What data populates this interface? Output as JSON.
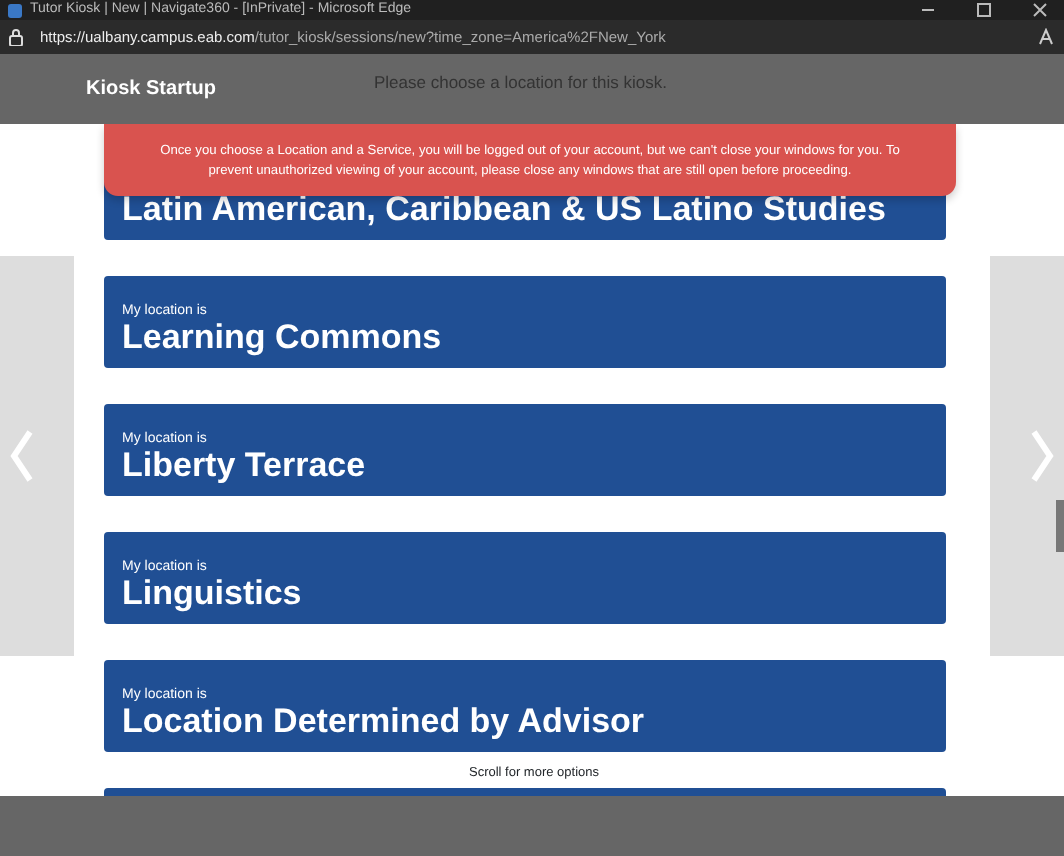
{
  "window": {
    "title": "Tutor Kiosk | New | Navigate360 - [InPrivate] - Microsoft Edge"
  },
  "address_bar": {
    "url_host": "https://ualbany.campus.eab.com",
    "url_path": "/tutor_kiosk/sessions/new?time_zone=America%2FNew_York"
  },
  "header": {
    "title": "Kiosk Startup",
    "prompt": "Please choose a location for this kiosk."
  },
  "alert": {
    "text": "Once you choose a Location and a Service, you will be logged out of your account, but we can't close your windows for you. To prevent unauthorized viewing of your account, please close any windows that are still open before proceeding."
  },
  "locations": [
    {
      "name": "Latin American, Caribbean & US Latino Studies"
    },
    {
      "label": "My location is",
      "name": "Learning Commons"
    },
    {
      "label": "My location is",
      "name": "Liberty Terrace"
    },
    {
      "label": "My location is",
      "name": "Linguistics"
    },
    {
      "label": "My location is",
      "name": "Location Determined by Advisor"
    }
  ],
  "scroll_hint": "Scroll for more options"
}
